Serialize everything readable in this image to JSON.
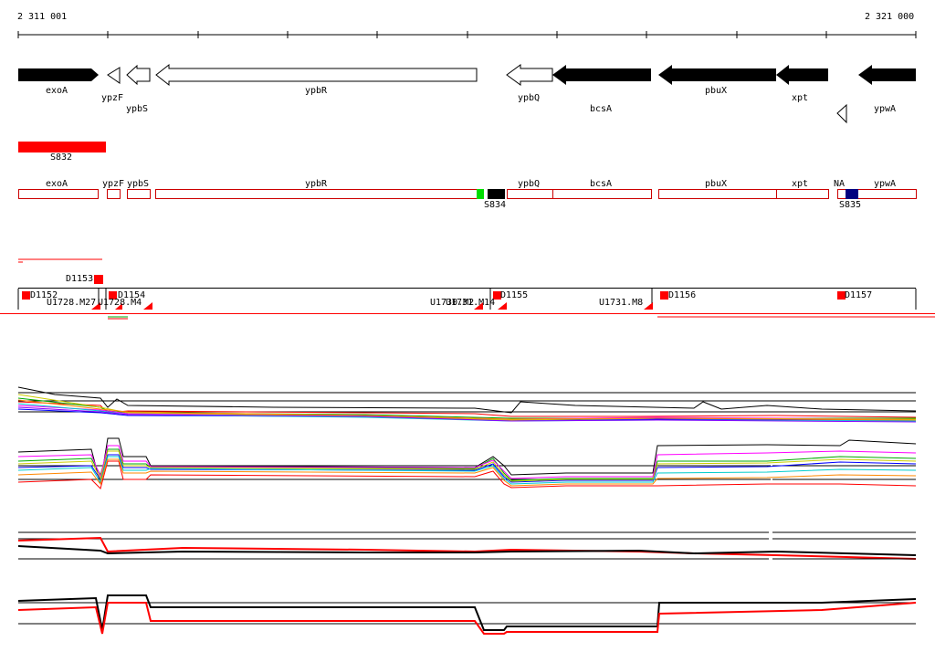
{
  "coords": {
    "start": "2 311 001",
    "end": "2 321 000"
  },
  "genes": [
    {
      "name": "exoA",
      "strand": "filled"
    },
    {
      "name": "ypzF",
      "strand": "open"
    },
    {
      "name": "ypbS",
      "strand": "open"
    },
    {
      "name": "ypbR",
      "strand": "open"
    },
    {
      "name": "ypbQ",
      "strand": "open"
    },
    {
      "name": "bcsA",
      "strand": "filled"
    },
    {
      "name": "pbuX",
      "strand": "filled"
    },
    {
      "name": "xpt",
      "strand": "filled"
    },
    {
      "name": "ypwA",
      "strand": "filled"
    }
  ],
  "feature_S832": "S832",
  "segments": [
    "exoA",
    "ypzF",
    "ypbS",
    "ypbR",
    "ypbQ",
    "bcsA",
    "pbuX",
    "xpt",
    "NA",
    "ypwA"
  ],
  "markers": {
    "s834": "S834",
    "s835": "S835"
  },
  "marker_colors": {
    "s834": "#00dd00",
    "s834_box": "#000000",
    "s835": "#000080"
  },
  "d_labels": [
    "D1153",
    "D1152",
    "D1154",
    "D1155",
    "D1156",
    "D1157"
  ],
  "u_labels": [
    "U1728.M27",
    "U1728.M4",
    "U1730.M2",
    "U1731.M14",
    "U1731.M8"
  ],
  "colors": {
    "feature": "#ff0000",
    "outline": "#cc0000",
    "axis": "#000000"
  }
}
